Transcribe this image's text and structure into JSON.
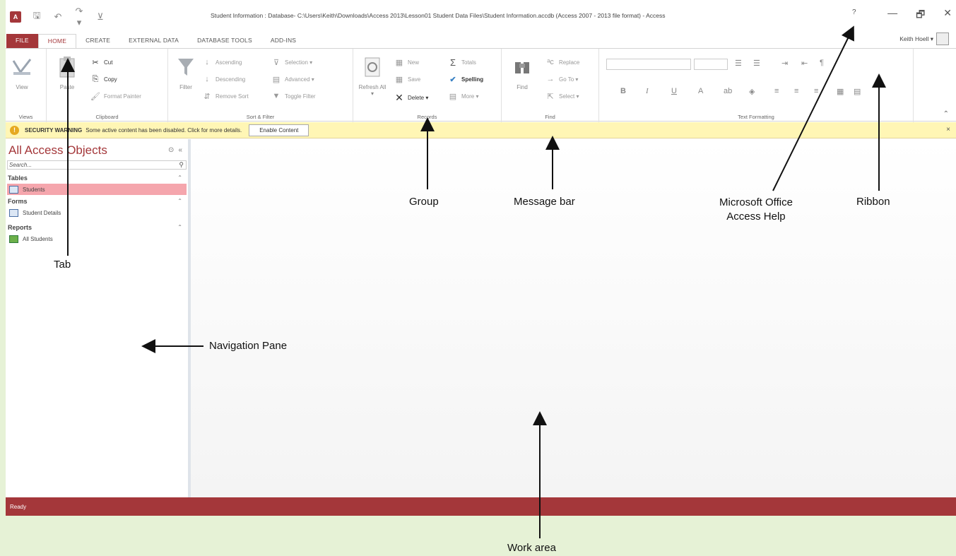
{
  "window": {
    "title": "Student Information : Database- C:\\Users\\Keith\\Downloads\\Access 2013\\Lesson01 Student Data Files\\Student Information.accdb (Access 2007 - 2013 file format) - Access",
    "help": "?",
    "minimize": "—",
    "restore": "🗗",
    "close": "✕",
    "user": "Keith Hoell ▾"
  },
  "qat": {
    "logo": "A",
    "save": "🖫",
    "undo": "↶",
    "redo": "↷ ▾",
    "customize": "⊻"
  },
  "tabs": [
    "FILE",
    "HOME",
    "CREATE",
    "EXTERNAL DATA",
    "DATABASE TOOLS",
    "ADD-INS"
  ],
  "ribbon": {
    "views": {
      "view": "View",
      "label": "Views"
    },
    "clipboard": {
      "paste": "Paste",
      "cut": "Cut",
      "copy": "Copy",
      "format_painter": "Format Painter",
      "label": "Clipboard"
    },
    "sort_filter": {
      "filter": "Filter",
      "ascending": "Ascending",
      "descending": "Descending",
      "remove_sort": "Remove Sort",
      "selection": "Selection ▾",
      "advanced": "Advanced ▾",
      "toggle_filter": "Toggle Filter",
      "label": "Sort & Filter"
    },
    "records": {
      "refresh": "Refresh All ▾",
      "new": "New",
      "save": "Save",
      "delete": "Delete ▾",
      "totals": "Totals",
      "spelling": "Spelling",
      "more": "More ▾",
      "label": "Records"
    },
    "find": {
      "find": "Find",
      "replace": "Replace",
      "goto": "Go To ▾",
      "select": "Select ▾",
      "label": "Find"
    },
    "text_formatting": {
      "bold": "B",
      "italic": "I",
      "underline": "U",
      "label": "Text Formatting"
    }
  },
  "message_bar": {
    "title": "SECURITY WARNING",
    "text": "Some active content has been disabled. Click for more details.",
    "button": "Enable Content",
    "close": "×"
  },
  "nav": {
    "title": "All Access Objects",
    "search_placeholder": "Search...",
    "sections": [
      {
        "label": "Tables",
        "items": [
          "Students"
        ]
      },
      {
        "label": "Forms",
        "items": [
          "Student Details"
        ]
      },
      {
        "label": "Reports",
        "items": [
          "All Students"
        ]
      }
    ]
  },
  "status": {
    "text": "Ready"
  },
  "callouts": {
    "tab": "Tab",
    "group": "Group",
    "message_bar": "Message bar",
    "help_line1": "Microsoft Office",
    "help_line2": "Access Help",
    "ribbon": "Ribbon",
    "navigation_pane": "Navigation Pane",
    "work_area": "Work area"
  }
}
